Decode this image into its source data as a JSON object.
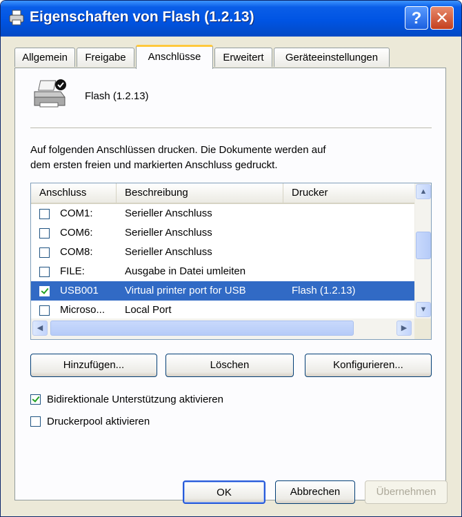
{
  "window": {
    "title": "Eigenschaften von Flash (1.2.13)",
    "help_label": "?",
    "close_label": "✕",
    "icon": "printer-icon"
  },
  "tabs": [
    {
      "label": "Allgemein",
      "active": false
    },
    {
      "label": "Freigabe",
      "active": false
    },
    {
      "label": "Anschlüsse",
      "active": true
    },
    {
      "label": "Erweitert",
      "active": false
    },
    {
      "label": "Geräteeinstellungen",
      "active": false
    }
  ],
  "printer": {
    "name": "Flash (1.2.13)",
    "icon": "printer-default-icon"
  },
  "info_text_line1": "Auf folgenden Anschlüssen drucken. Die Dokumente werden auf",
  "info_text_line2": "dem ersten freien und markierten Anschluss gedruckt.",
  "port_list": {
    "columns": [
      "Anschluss",
      "Beschreibung",
      "Drucker"
    ],
    "rows": [
      {
        "checked": false,
        "port": "COM1:",
        "description": "Serieller Anschluss",
        "printer": "",
        "selected": false
      },
      {
        "checked": false,
        "port": "COM6:",
        "description": "Serieller Anschluss",
        "printer": "",
        "selected": false
      },
      {
        "checked": false,
        "port": "COM8:",
        "description": "Serieller Anschluss",
        "printer": "",
        "selected": false
      },
      {
        "checked": false,
        "port": "FILE:",
        "description": "Ausgabe in Datei umleiten",
        "printer": "",
        "selected": false
      },
      {
        "checked": true,
        "port": "USB001",
        "description": "Virtual printer port for USB",
        "printer": "Flash (1.2.13)",
        "selected": true
      },
      {
        "checked": false,
        "port": "Microso...",
        "description": "Local Port",
        "printer": "",
        "selected": false
      }
    ]
  },
  "buttons": {
    "add": "Hinzufügen...",
    "delete": "Löschen",
    "configure": "Konfigurieren..."
  },
  "options": {
    "bidirectional_label": "Bidirektionale Unterstützung aktivieren",
    "bidirectional_checked": true,
    "pool_label": "Druckerpool aktivieren",
    "pool_checked": false
  },
  "footer": {
    "ok": "OK",
    "cancel": "Abbrechen",
    "apply": "Übernehmen",
    "apply_enabled": false
  },
  "colors": {
    "title_bar": "#0054e3",
    "selection": "#316ac5",
    "active_tab_accent": "#ffc83c"
  }
}
